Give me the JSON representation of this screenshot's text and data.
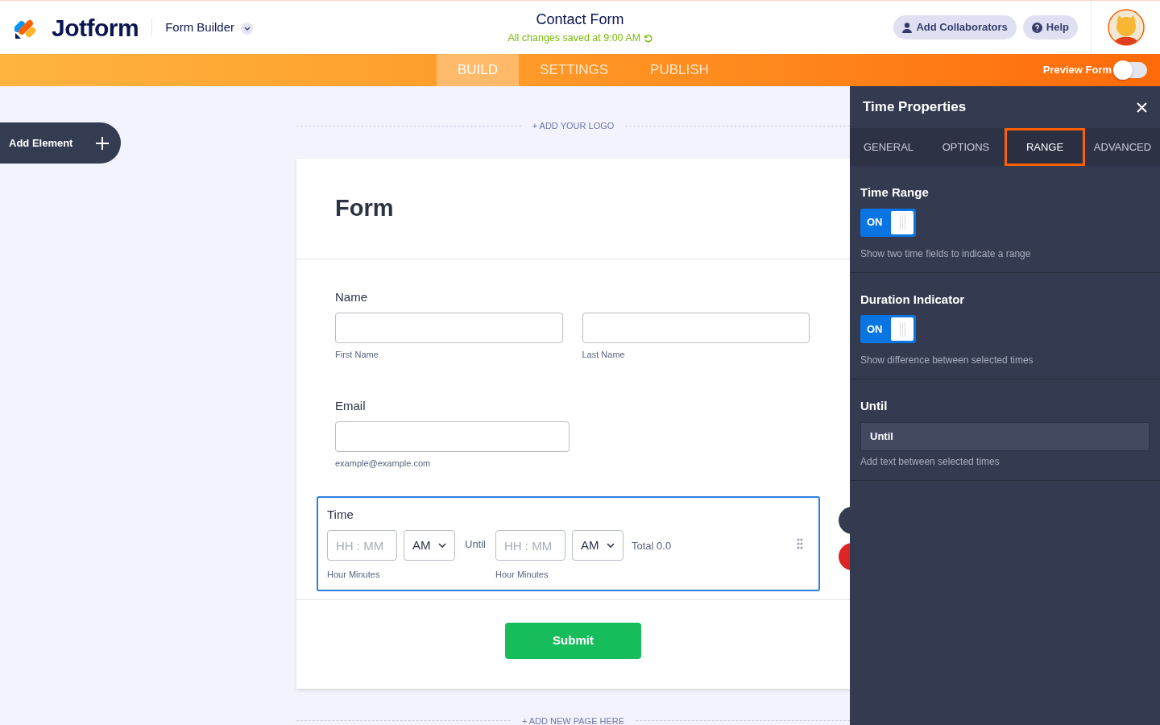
{
  "header": {
    "logo": "Jotform",
    "builder": "Form Builder",
    "title": "Contact Form",
    "saved": "All changes saved at 9:00 AM",
    "buttons": [
      {
        "kind": "user",
        "label": "Add Collaborators"
      },
      {
        "kind": "help",
        "label": "Help"
      }
    ]
  },
  "nav": {
    "tabs": [
      {
        "label": "BUILD",
        "selected": true
      },
      {
        "label": "SETTINGS",
        "selected": false
      },
      {
        "label": "PUBLISH",
        "selected": false
      }
    ],
    "preview": {
      "label": "Preview Form",
      "on": false
    }
  },
  "add_element": "Add Element",
  "canvas": {
    "add_logo": "+ ADD YOUR LOGO",
    "form_title": "Form",
    "fields": [
      {
        "kind": "name",
        "label": "Name",
        "selected": false,
        "sublabels": [
          "First Name",
          "Last Name"
        ]
      },
      {
        "kind": "email",
        "label": "Email",
        "selected": false,
        "sublabels": [
          "example@example.com"
        ]
      },
      {
        "kind": "time",
        "label": "Time",
        "selected": true,
        "separator": "Until",
        "total": "Total 0.0",
        "inputs": [
          {
            "placeholder": "HH : MM",
            "ampm": "AM",
            "sublabel": "Hour Minutes"
          },
          {
            "placeholder": "HH : MM",
            "ampm": "AM",
            "sublabel": "Hour Minutes"
          }
        ]
      }
    ],
    "submit": "Submit",
    "add_page": "+ ADD NEW PAGE HERE"
  },
  "panel": {
    "title": "Time Properties",
    "tabs": [
      {
        "label": "GENERAL",
        "selected": false
      },
      {
        "label": "OPTIONS",
        "selected": false
      },
      {
        "label": "RANGE",
        "selected": true
      },
      {
        "label": "ADVANCED",
        "selected": false
      }
    ],
    "sections": [
      {
        "kind": "toggle",
        "title": "Time Range",
        "toggle_label": "ON",
        "on": true,
        "description": "Show two time fields to indicate a range"
      },
      {
        "kind": "toggle",
        "title": "Duration Indicator",
        "toggle_label": "ON",
        "on": true,
        "description": "Show difference between selected times"
      },
      {
        "kind": "text",
        "title": "Until",
        "value": "Until",
        "description": "Add text between selected times"
      }
    ]
  }
}
